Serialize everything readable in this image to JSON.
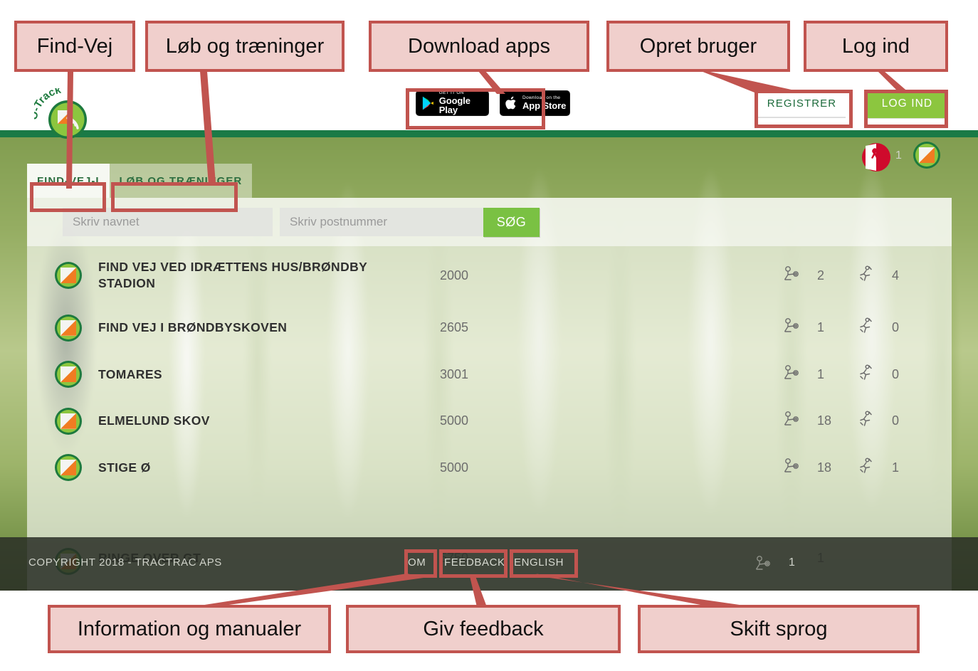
{
  "annotations": {
    "top": [
      {
        "id": "find-vej",
        "label": "Find-Vej"
      },
      {
        "id": "lob-traening",
        "label": "Løb og træninger"
      },
      {
        "id": "download-apps",
        "label": "Download apps"
      },
      {
        "id": "opret-bruger",
        "label": "Opret bruger"
      },
      {
        "id": "log-ind",
        "label": "Log ind"
      }
    ],
    "bottom": [
      {
        "id": "information",
        "label": "Information og manualer"
      },
      {
        "id": "giv-feedback",
        "label": "Giv feedback"
      },
      {
        "id": "skift-sprog",
        "label": "Skift sprog"
      }
    ],
    "box_fill": "#f0cfcc",
    "box_border": "#c1544f"
  },
  "topbar": {
    "logo_text": "O-Track",
    "store_badges": [
      {
        "id": "google-play",
        "small": "GET IT ON",
        "big": "Google Play"
      },
      {
        "id": "app-store",
        "small": "Download on the",
        "big": "App Store"
      }
    ],
    "register_label": "REGISTRER",
    "login_label": "LOG IND"
  },
  "tabs": [
    {
      "id": "find-vej-i",
      "label": "FIND-VEJ-I",
      "active": true
    },
    {
      "id": "lob-og-traeninger",
      "label": "LØB OG TRÆNINGER",
      "active": false
    }
  ],
  "search": {
    "name_placeholder": "Skriv navnet",
    "name_value": "",
    "zip_placeholder": "Skriv postnummer",
    "zip_value": "",
    "button_label": "SØG"
  },
  "list": {
    "rows": [
      {
        "name": "FIND VEJ VED IDRÆTTENS HUS/BRØNDBY STADION",
        "zip": "2000",
        "maps": "2",
        "events": "4"
      },
      {
        "name": "FIND VEJ I BRØNDBYSKOVEN",
        "zip": "2605",
        "maps": "1",
        "events": "0"
      },
      {
        "name": "TOMARES",
        "zip": "3001",
        "maps": "1",
        "events": "0"
      },
      {
        "name": "ELMELUND SKOV",
        "zip": "5000",
        "maps": "18",
        "events": "0"
      },
      {
        "name": "STIGE Ø",
        "zip": "5000",
        "maps": "18",
        "events": "1"
      }
    ],
    "partial_row": {
      "name": "RINGE OVER GT...",
      "zip": "5750",
      "maps": "1"
    }
  },
  "footer": {
    "copyright": "COPYRIGHT 2018 - TRACTRAC APS",
    "links": [
      {
        "id": "om",
        "label": "OM"
      },
      {
        "id": "feedback",
        "label": "FEEDBACK"
      },
      {
        "id": "english",
        "label": "ENGLISH"
      }
    ],
    "badge_count": "1"
  },
  "colors": {
    "green_bar": "#1a7a46",
    "accent_green": "#8cc63f",
    "search_green": "#7ac143",
    "tab_text": "#2d6e40",
    "footer_bg": "#2a2e26",
    "control_orange": "#f07c22"
  }
}
